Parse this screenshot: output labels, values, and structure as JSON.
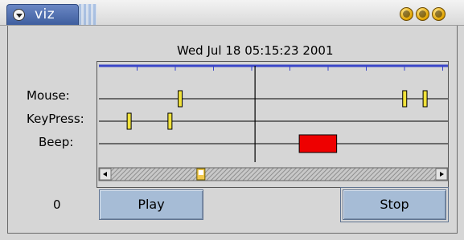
{
  "window": {
    "title": "viz",
    "controls": [
      "minimize-icon",
      "maximize-icon",
      "close-icon"
    ]
  },
  "timestamp": "Wed Jul 18 05:15:23 2001",
  "tracks": [
    {
      "label": "Mouse:",
      "events": [
        {
          "t": 0.22,
          "kind": "marker"
        },
        {
          "t": 0.88,
          "kind": "marker"
        },
        {
          "t": 0.94,
          "kind": "marker"
        }
      ]
    },
    {
      "label": "KeyPress:",
      "events": [
        {
          "t": 0.07,
          "kind": "marker"
        },
        {
          "t": 0.19,
          "kind": "marker"
        }
      ]
    },
    {
      "label": "Beep:",
      "events": [
        {
          "t0": 0.57,
          "t1": 0.68,
          "kind": "block"
        }
      ]
    }
  ],
  "cursor_position": 0.44,
  "scroll_position": 0.27,
  "counter": "0",
  "buttons": {
    "play": "Play",
    "stop": "Stop"
  },
  "colors": {
    "accent": "#3b46c8",
    "marker": "#f0e23a",
    "beep": "#ee0000",
    "button": "#a6bcd6",
    "titlebar_tab": "#4a6aaa"
  }
}
